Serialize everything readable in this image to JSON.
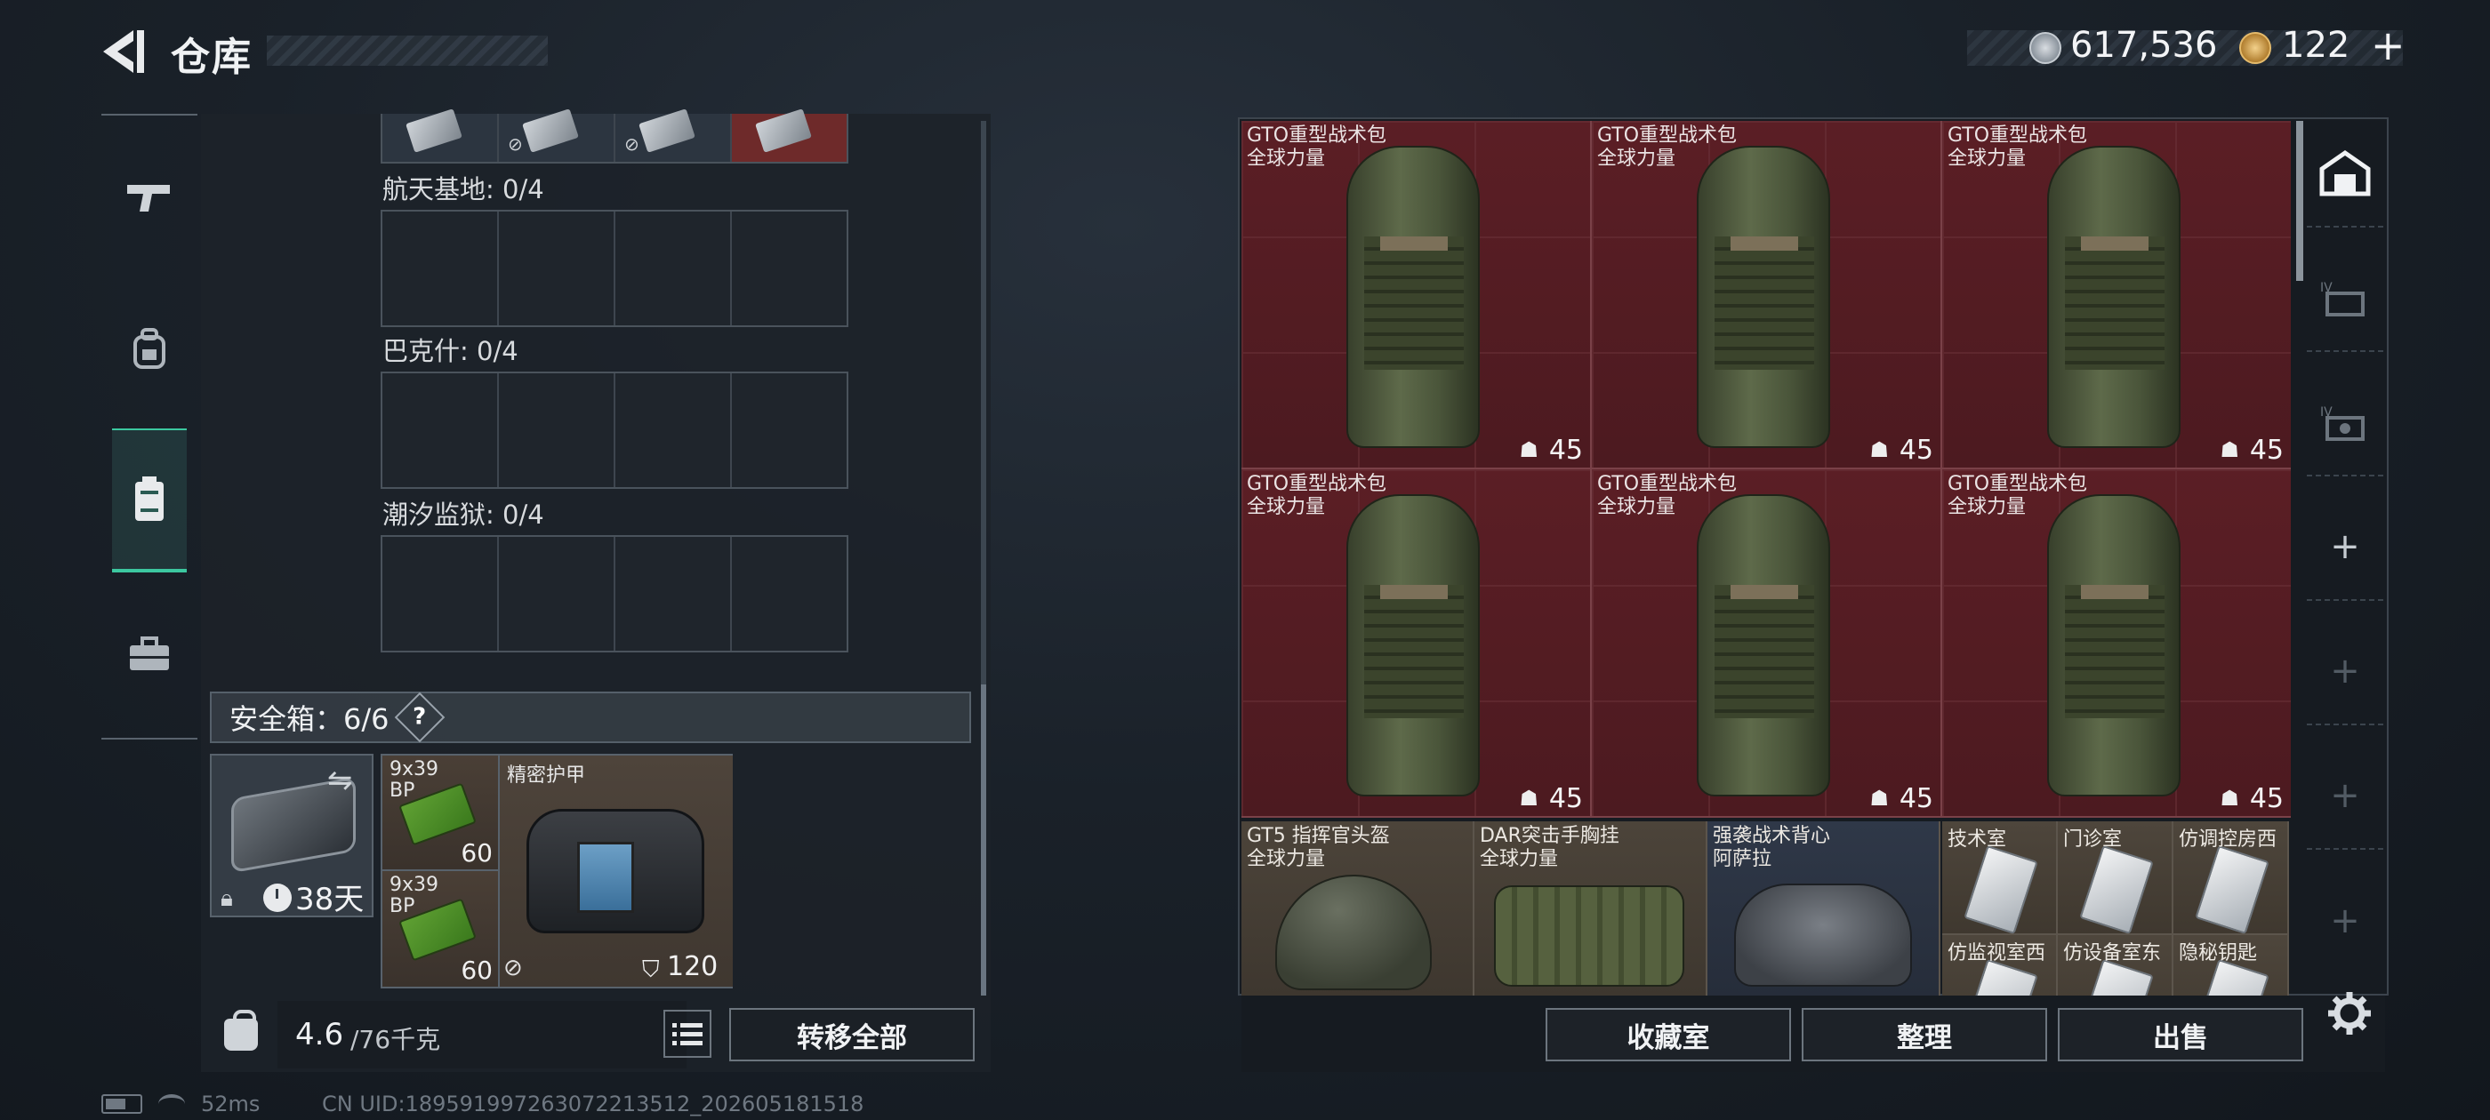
{
  "header": {
    "title": "仓库",
    "back_icon": "back-arrow-icon",
    "coin_icon": "coin-icon",
    "coin_value": "617,536",
    "ticket_icon": "ticket-icon",
    "ticket_value": "122",
    "ticket_plus": "+"
  },
  "rail": [
    {
      "icon": "weapon-icon"
    },
    {
      "icon": "backpack-icon"
    },
    {
      "icon": "container-icon",
      "selected": true
    },
    {
      "icon": "case-icon"
    }
  ],
  "left": {
    "maps": [
      {
        "label": "航天基地: 0/4"
      },
      {
        "label": "巴克什: 0/4"
      },
      {
        "label": "潮汐监狱: 0/4"
      }
    ],
    "safe": {
      "title": "安全箱：6/6",
      "help": "?",
      "days": "38天",
      "swap_icon": "swap-icon",
      "lock_icon": "lock-icon",
      "clock_icon": "clock-icon",
      "ammo": [
        {
          "name": "9x39 BP",
          "count": "60"
        },
        {
          "name": "9x39 BP",
          "count": "60"
        }
      ],
      "armor": {
        "name": "精密护甲",
        "durability": "120"
      }
    },
    "weight": {
      "current": "4.6",
      "max": "/76千克"
    },
    "transfer_label": "转移全部"
  },
  "stash": {
    "backpacks": [
      {
        "name": "GTO重型战术包",
        "source": "全球力量",
        "capacity": "45"
      },
      {
        "name": "GTO重型战术包",
        "source": "全球力量",
        "capacity": "45"
      },
      {
        "name": "GTO重型战术包",
        "source": "全球力量",
        "capacity": "45"
      },
      {
        "name": "GTO重型战术包",
        "source": "全球力量",
        "capacity": "45"
      },
      {
        "name": "GTO重型战术包",
        "source": "全球力量",
        "capacity": "45"
      },
      {
        "name": "GTO重型战术包",
        "source": "全球力量",
        "capacity": "45"
      }
    ],
    "items": [
      {
        "name": "GT5 指挥官头盔",
        "source": "全球力量"
      },
      {
        "name": "DAR突击手胸挂",
        "source": "全球力量"
      },
      {
        "name": "强袭战术背心",
        "source": "阿萨拉"
      }
    ],
    "keys": [
      {
        "name": "技术室"
      },
      {
        "name": "门诊室"
      },
      {
        "name": "仿调控房西"
      },
      {
        "name": "仿监视室西"
      },
      {
        "name": "仿设备室东"
      },
      {
        "name": "隐秘钥匙"
      }
    ],
    "buttons": {
      "collection": "收藏室",
      "tidy": "整理",
      "sell": "出售"
    }
  },
  "status": {
    "ping": "52ms",
    "uid": "CN UID:1895919972630722​13512_202605181518"
  }
}
